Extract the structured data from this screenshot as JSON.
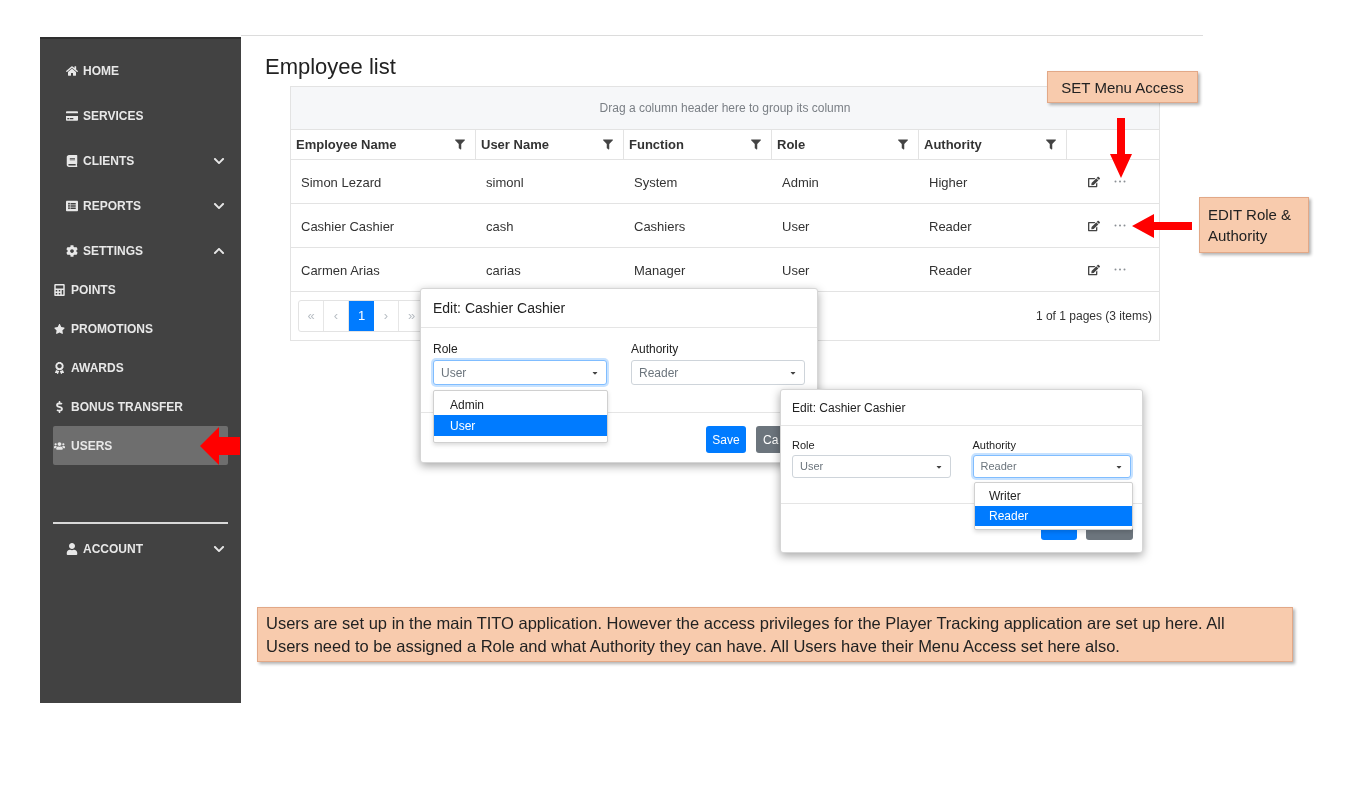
{
  "sidebar": {
    "items": [
      {
        "label": "HOME",
        "selected": false
      },
      {
        "label": "SERVICES",
        "selected": false
      },
      {
        "label": "CLIENTS",
        "selected": false,
        "expanded": false
      },
      {
        "label": "REPORTS",
        "selected": false,
        "expanded": false
      },
      {
        "label": "SETTINGS",
        "selected": false,
        "expanded": true,
        "children": [
          {
            "label": "POINTS",
            "selected": false
          },
          {
            "label": "PROMOTIONS",
            "selected": false
          },
          {
            "label": "AWARDS",
            "selected": false
          },
          {
            "label": "BONUS TRANSFER",
            "selected": false
          },
          {
            "label": "USERS",
            "selected": true
          }
        ]
      }
    ],
    "account": {
      "label": "ACCOUNT",
      "selected": false,
      "expanded": false
    }
  },
  "page_title": "Employee list",
  "grid": {
    "group_panel": "Drag a column header here to group its column",
    "columns": [
      {
        "label": "Employee Name",
        "filter": true
      },
      {
        "label": "User Name",
        "filter": true
      },
      {
        "label": "Function",
        "filter": true
      },
      {
        "label": "Role",
        "filter": true
      },
      {
        "label": "Authority",
        "filter": true
      }
    ],
    "rows": [
      {
        "cells": [
          "Simon Lezard",
          "simonl",
          "System",
          "Admin",
          "Higher"
        ]
      },
      {
        "cells": [
          "Cashier Cashier",
          "cash",
          "Cashiers",
          "User",
          "Reader"
        ]
      },
      {
        "cells": [
          "Carmen Arias",
          "carias",
          "Manager",
          "User",
          "Reader"
        ]
      }
    ],
    "pager": {
      "first": "«",
      "previous": "‹",
      "pages": [
        {
          "label": "1",
          "selected": true
        }
      ],
      "next": "›",
      "last": "»",
      "info": "1 of 1 pages (3 items)"
    }
  },
  "dialogs": [
    {
      "title": "Edit: Cashier Cashier",
      "fields": [
        {
          "label": "Role",
          "value": "User",
          "focused": true,
          "options": [
            {
              "label": "Admin",
              "selected": false
            },
            {
              "label": "User",
              "selected": true
            }
          ]
        },
        {
          "label": "Authority",
          "value": "Reader",
          "focused": false
        }
      ],
      "buttons": [
        {
          "kind": "primary",
          "label": "Save"
        },
        {
          "kind": "secondary",
          "label": "Ca"
        }
      ]
    },
    {
      "title": "Edit: Cashier Cashier",
      "fields": [
        {
          "label": "Role",
          "value": "User",
          "focused": false
        },
        {
          "label": "Authority",
          "value": "Reader",
          "focused": true,
          "options": [
            {
              "label": "Writer",
              "selected": false
            },
            {
              "label": "Reader",
              "selected": true
            }
          ]
        }
      ],
      "buttons": [
        {
          "kind": "primary"
        },
        {
          "kind": "secondary"
        }
      ]
    }
  ],
  "annotations": [
    {
      "text": "SET Menu Access"
    },
    {
      "text": "EDIT Role & Authority"
    }
  ],
  "note": "Users are set up in the main TITO application. However the access privileges for the Player Tracking application are set up here. All Users need to be assigned a Role and what Authority they can have. All Users have their Menu Access set here also."
}
